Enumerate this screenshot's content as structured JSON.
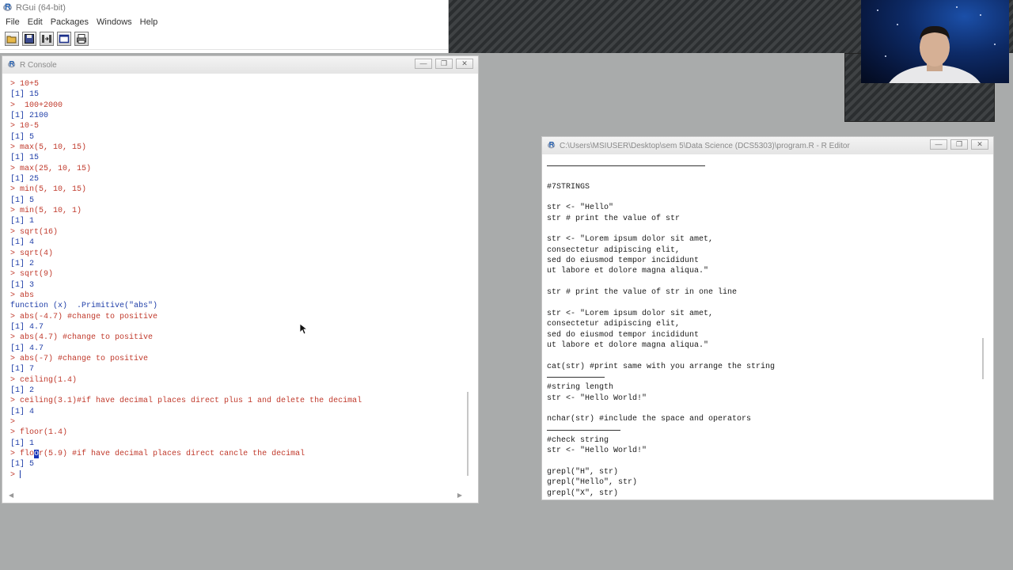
{
  "rgui": {
    "title": "RGui (64-bit)",
    "menu": [
      "File",
      "Edit",
      "Packages",
      "Windows",
      "Help"
    ],
    "toolbar_icons": [
      "open-script-icon",
      "save-icon",
      "load-workspace-icon",
      "console-icon",
      "print-icon"
    ]
  },
  "console": {
    "title": "R Console",
    "lines": [
      {
        "kind": "in",
        "text": "> 10+5"
      },
      {
        "kind": "out",
        "text": "[1] 15"
      },
      {
        "kind": "in",
        "text": ">  100+2000"
      },
      {
        "kind": "out",
        "text": "[1] 2100"
      },
      {
        "kind": "in",
        "text": "> 10-5"
      },
      {
        "kind": "out",
        "text": "[1] 5"
      },
      {
        "kind": "in",
        "text": "> max(5, 10, 15)"
      },
      {
        "kind": "out",
        "text": "[1] 15"
      },
      {
        "kind": "in",
        "text": "> max(25, 10, 15)"
      },
      {
        "kind": "out",
        "text": "[1] 25"
      },
      {
        "kind": "in",
        "text": "> min(5, 10, 15)"
      },
      {
        "kind": "out",
        "text": "[1] 5"
      },
      {
        "kind": "in",
        "text": "> min(5, 10, 1)"
      },
      {
        "kind": "out",
        "text": "[1] 1"
      },
      {
        "kind": "in",
        "text": "> sqrt(16)"
      },
      {
        "kind": "out",
        "text": "[1] 4"
      },
      {
        "kind": "in",
        "text": "> sqrt(4)"
      },
      {
        "kind": "out",
        "text": "[1] 2"
      },
      {
        "kind": "in",
        "text": "> sqrt(9)"
      },
      {
        "kind": "out",
        "text": "[1] 3"
      },
      {
        "kind": "in",
        "text": "> abs"
      },
      {
        "kind": "out",
        "text": "function (x)  .Primitive(\"abs\")"
      },
      {
        "kind": "in",
        "text": "> abs(-4.7) #change to positive"
      },
      {
        "kind": "out",
        "text": "[1] 4.7"
      },
      {
        "kind": "in",
        "text": "> abs(4.7) #change to positive"
      },
      {
        "kind": "out",
        "text": "[1] 4.7"
      },
      {
        "kind": "in",
        "text": "> abs(-7) #change to positive"
      },
      {
        "kind": "out",
        "text": "[1] 7"
      },
      {
        "kind": "in",
        "text": "> ceiling(1.4)"
      },
      {
        "kind": "out",
        "text": "[1] 2"
      },
      {
        "kind": "in",
        "text": "> ceiling(3.1)#if have decimal places direct plus 1 and delete the decimal"
      },
      {
        "kind": "out",
        "text": "[1] 4"
      },
      {
        "kind": "in",
        "text": ">"
      },
      {
        "kind": "in",
        "text": "> floor(1.4)"
      },
      {
        "kind": "out",
        "text": "[1] 1"
      },
      {
        "kind": "in",
        "text": "> floor(5.9) #if have decimal places direct cancle the decimal"
      },
      {
        "kind": "out",
        "text": "[1] 5"
      }
    ],
    "prompt": ">"
  },
  "editor": {
    "title": "C:\\Users\\MSIUSER\\Desktop\\sem 5\\Data Science (DCS5303)\\program.R - R Editor",
    "lines": [
      {
        "kind": "sep",
        "w": 200
      },
      {
        "kind": "text",
        "text": ""
      },
      {
        "kind": "text",
        "text": "#7STRINGS"
      },
      {
        "kind": "text",
        "text": ""
      },
      {
        "kind": "text",
        "text": "str <- \"Hello\""
      },
      {
        "kind": "text",
        "text": "str # print the value of str"
      },
      {
        "kind": "text",
        "text": ""
      },
      {
        "kind": "text",
        "text": "str <- \"Lorem ipsum dolor sit amet,"
      },
      {
        "kind": "text",
        "text": "consectetur adipiscing elit,"
      },
      {
        "kind": "text",
        "text": "sed do eiusmod tempor incididunt"
      },
      {
        "kind": "text",
        "text": "ut labore et dolore magna aliqua.\""
      },
      {
        "kind": "text",
        "text": ""
      },
      {
        "kind": "text",
        "text": "str # print the value of str in one line"
      },
      {
        "kind": "text",
        "text": ""
      },
      {
        "kind": "text",
        "text": "str <- \"Lorem ipsum dolor sit amet,"
      },
      {
        "kind": "text",
        "text": "consectetur adipiscing elit,"
      },
      {
        "kind": "text",
        "text": "sed do eiusmod tempor incididunt"
      },
      {
        "kind": "text",
        "text": "ut labore et dolore magna aliqua.\""
      },
      {
        "kind": "text",
        "text": ""
      },
      {
        "kind": "text",
        "text": "cat(str) #print same with you arrange the string"
      },
      {
        "kind": "sep",
        "w": 73
      },
      {
        "kind": "text",
        "text": "#string length"
      },
      {
        "kind": "text",
        "text": "str <- \"Hello World!\""
      },
      {
        "kind": "text",
        "text": ""
      },
      {
        "kind": "text",
        "text": "nchar(str) #include the space and operators"
      },
      {
        "kind": "sep",
        "w": 93
      },
      {
        "kind": "text",
        "text": "#check string"
      },
      {
        "kind": "text",
        "text": "str <- \"Hello World!\""
      },
      {
        "kind": "text",
        "text": ""
      },
      {
        "kind": "text",
        "text": "grepl(\"H\", str)"
      },
      {
        "kind": "text",
        "text": "grepl(\"Hello\", str)"
      },
      {
        "kind": "text",
        "text": "grepl(\"X\", str)"
      }
    ]
  }
}
